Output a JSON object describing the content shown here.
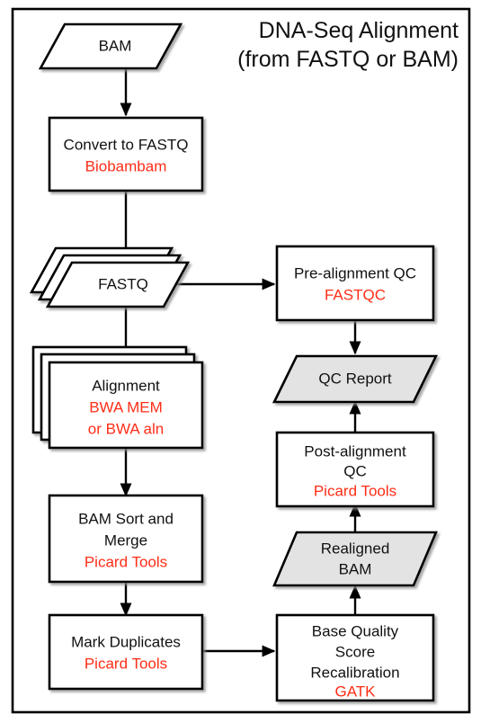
{
  "diagram": {
    "title_line1": "DNA-Seq Alignment",
    "title_line2": "(from FASTQ or BAM)",
    "colors": {
      "tool_text": "#FF2D17",
      "node_text": "#111111",
      "data_node_fill": "#E3E3E3",
      "process_node_fill": "#FFFFFF",
      "stroke": "#000000"
    },
    "nodes": {
      "bam_input": {
        "label": "BAM",
        "shape": "parallelogram",
        "fill": "white",
        "stacked": false
      },
      "convert_to_fastq": {
        "label": "Convert to FASTQ",
        "tool": "Biobambam",
        "shape": "rectangle",
        "fill": "white",
        "stacked": false
      },
      "fastq": {
        "label": "FASTQ",
        "shape": "parallelogram",
        "fill": "white",
        "stacked": true
      },
      "pre_alignment_qc": {
        "label": "Pre-alignment QC",
        "tool": "FASTQC",
        "shape": "rectangle",
        "fill": "white",
        "stacked": false
      },
      "qc_report": {
        "label": "QC Report",
        "shape": "parallelogram",
        "fill": "gray",
        "stacked": false
      },
      "alignment": {
        "label": "Alignment",
        "tool_line1": "BWA MEM",
        "tool_line2": "or BWA aln",
        "shape": "rectangle",
        "fill": "white",
        "stacked": true
      },
      "post_alignment_qc": {
        "label_line1": "Post-alignment",
        "label_line2": "QC",
        "tool": "Picard Tools",
        "shape": "rectangle",
        "fill": "white",
        "stacked": false
      },
      "bam_sort_merge": {
        "label_line1": "BAM Sort and",
        "label_line2": "Merge",
        "tool": "Picard Tools",
        "shape": "rectangle",
        "fill": "white",
        "stacked": false
      },
      "realigned_bam": {
        "label_line1": "Realigned",
        "label_line2": "BAM",
        "shape": "parallelogram",
        "fill": "gray",
        "stacked": false
      },
      "mark_duplicates": {
        "label": "Mark Duplicates",
        "tool": "Picard Tools",
        "shape": "rectangle",
        "fill": "white",
        "stacked": false
      },
      "base_quality_recalibration": {
        "label_line1": "Base Quality",
        "label_line2": "Score",
        "label_line3": "Recalibration",
        "tool": "GATK",
        "shape": "rectangle",
        "fill": "white",
        "stacked": false
      }
    },
    "edges": [
      {
        "from": "bam_input",
        "to": "convert_to_fastq",
        "direction": "down"
      },
      {
        "from": "convert_to_fastq",
        "to": "fastq",
        "direction": "down"
      },
      {
        "from": "fastq",
        "to": "pre_alignment_qc",
        "direction": "right"
      },
      {
        "from": "fastq",
        "to": "alignment",
        "direction": "down"
      },
      {
        "from": "pre_alignment_qc",
        "to": "qc_report",
        "direction": "down"
      },
      {
        "from": "post_alignment_qc",
        "to": "qc_report",
        "direction": "up"
      },
      {
        "from": "alignment",
        "to": "bam_sort_merge",
        "direction": "down"
      },
      {
        "from": "bam_sort_merge",
        "to": "mark_duplicates",
        "direction": "down"
      },
      {
        "from": "mark_duplicates",
        "to": "base_quality_recalibration",
        "direction": "right"
      },
      {
        "from": "base_quality_recalibration",
        "to": "realigned_bam",
        "direction": "up"
      },
      {
        "from": "realigned_bam",
        "to": "post_alignment_qc",
        "direction": "up"
      }
    ]
  }
}
